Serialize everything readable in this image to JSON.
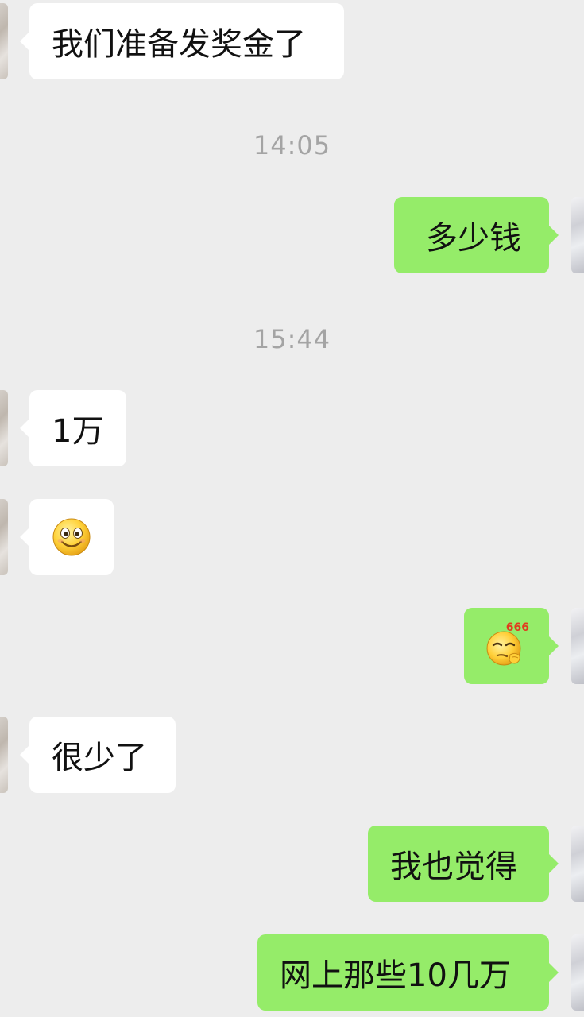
{
  "messages": [
    {
      "side": "in",
      "text": "我们准备发奖金了"
    },
    {
      "side": "out",
      "text": "多少钱"
    },
    {
      "side": "in",
      "text": "1万"
    },
    {
      "side": "in",
      "emoji": "smile-emoji"
    },
    {
      "side": "out",
      "emoji": "666-thinking-emoji",
      "emoji_text": "666"
    },
    {
      "side": "in",
      "text": "很少了"
    },
    {
      "side": "out",
      "text": "我也觉得"
    },
    {
      "side": "out",
      "text": "网上那些10几万"
    }
  ],
  "timestamps": [
    "14:05",
    "15:44"
  ],
  "colors": {
    "background": "#ededed",
    "incoming_bubble": "#ffffff",
    "outgoing_bubble": "#95ec69",
    "timestamp": "#a4a4a4"
  }
}
